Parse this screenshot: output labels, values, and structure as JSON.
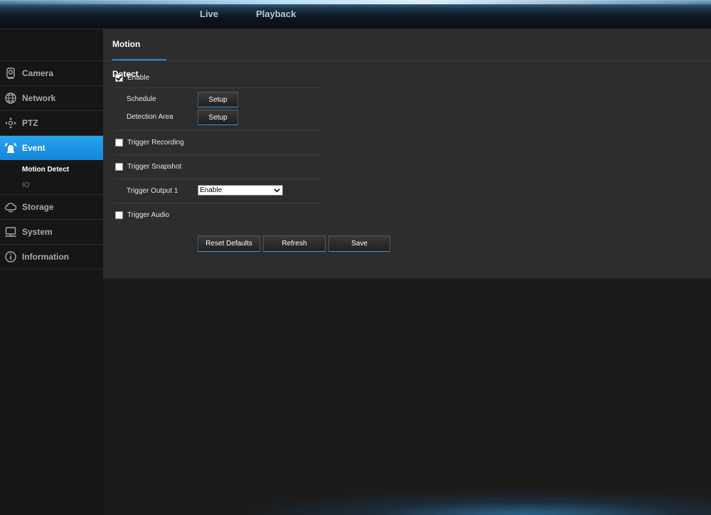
{
  "topnav": {
    "live": "Live",
    "playback": "Playback"
  },
  "sidebar": {
    "items": [
      {
        "label": "Camera",
        "icon": "camera-icon"
      },
      {
        "label": "Network",
        "icon": "network-globe-icon"
      },
      {
        "label": "PTZ",
        "icon": "ptz-arrows-icon"
      },
      {
        "label": "Event",
        "icon": "alarm-siren-icon",
        "active": true
      },
      {
        "label": "Storage",
        "icon": "cloud-storage-icon"
      },
      {
        "label": "System",
        "icon": "monitor-icon"
      },
      {
        "label": "Information",
        "icon": "info-icon"
      }
    ],
    "event_sub": [
      {
        "label": "Motion Detect",
        "active": true
      },
      {
        "label": "IO",
        "active": false
      }
    ]
  },
  "main": {
    "tab": "Motion Detect",
    "enable": {
      "label": "Enable",
      "checked": true
    },
    "schedule": {
      "label": "Schedule",
      "button": "Setup"
    },
    "detection_area": {
      "label": "Detection Area",
      "button": "Setup"
    },
    "trigger_recording": {
      "label": "Trigger Recording",
      "checked": false
    },
    "trigger_snapshot": {
      "label": "Trigger Snapshot",
      "checked": false
    },
    "trigger_output": {
      "label": "Trigger Output 1",
      "value": "Enable"
    },
    "trigger_audio": {
      "label": "Trigger Audio",
      "checked": false
    },
    "buttons": {
      "reset": "Reset Defaults",
      "refresh": "Refresh",
      "save": "Save"
    }
  },
  "colors": {
    "accent": "#1e8ce0",
    "panel": "#2d2d2d",
    "background": "#1b1b1b"
  }
}
